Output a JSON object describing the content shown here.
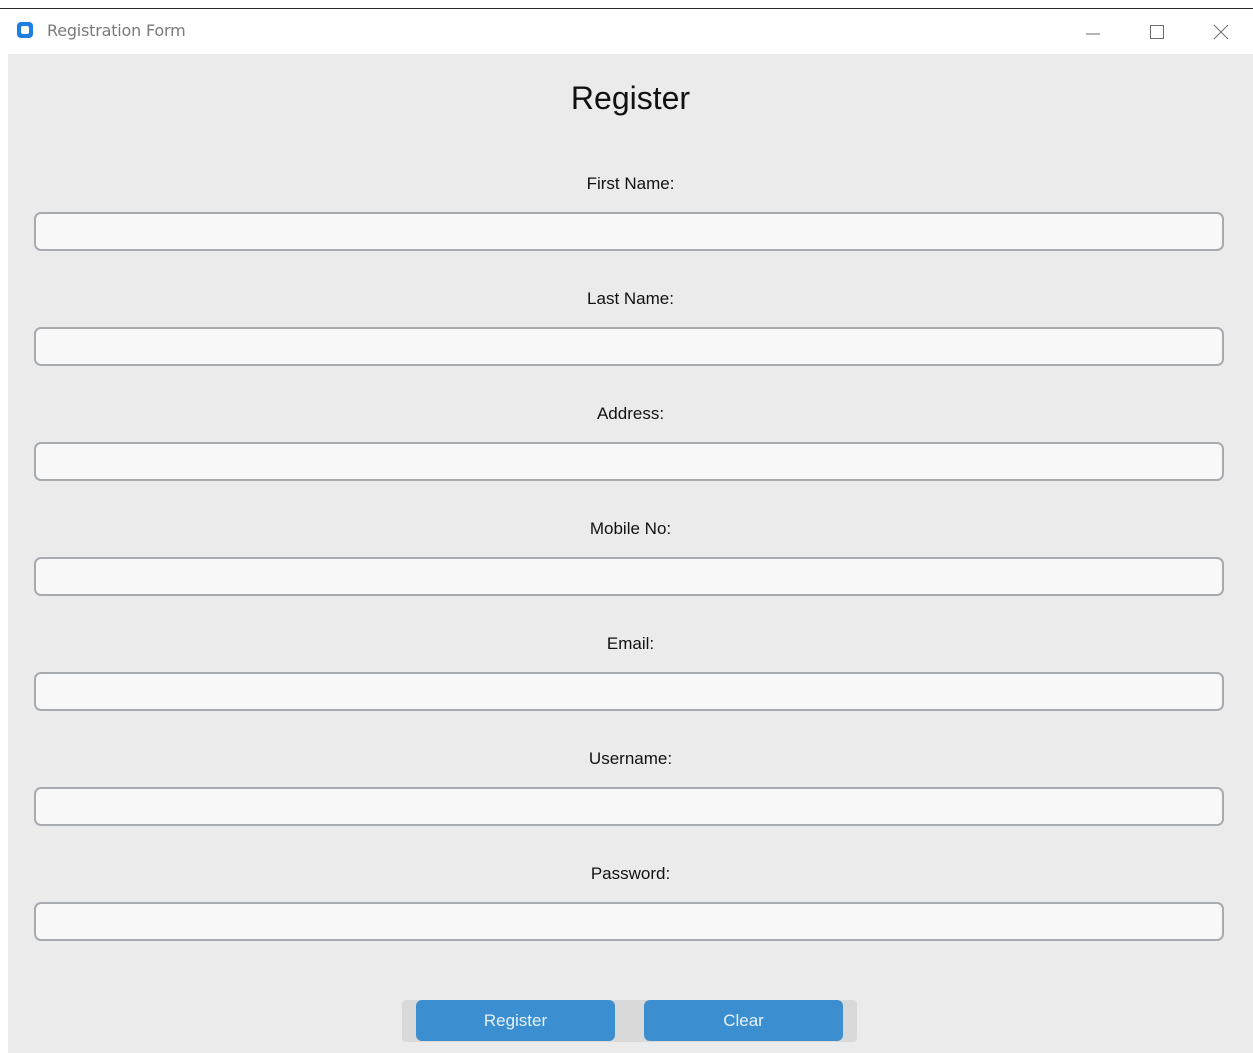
{
  "window": {
    "title": "Registration Form",
    "controls": [
      "minimize-icon",
      "maximize-icon",
      "close-icon"
    ]
  },
  "form": {
    "heading": "Register",
    "fields": [
      {
        "label": "First Name:",
        "value": "",
        "placeholder": ""
      },
      {
        "label": "Last Name:",
        "value": "",
        "placeholder": ""
      },
      {
        "label": "Address:",
        "value": "",
        "placeholder": ""
      },
      {
        "label": "Mobile No:",
        "value": "",
        "placeholder": ""
      },
      {
        "label": "Email:",
        "value": "",
        "placeholder": ""
      },
      {
        "label": "Username:",
        "value": "",
        "placeholder": ""
      },
      {
        "label": "Password:",
        "value": "",
        "placeholder": ""
      }
    ]
  },
  "buttons": {
    "register_label": "Register",
    "clear_label": "Clear"
  },
  "colors": {
    "accent": "#3b8ed0",
    "background": "#ebebeb",
    "input_border": "#a7abb0",
    "app_icon": "#1f7fe0"
  }
}
